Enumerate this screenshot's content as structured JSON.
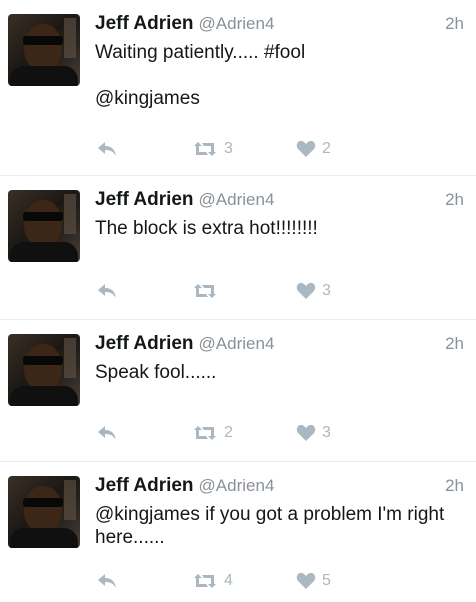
{
  "colors": {
    "icon": "#aab8c2",
    "handle": "#8a9298",
    "divider": "#e6ecf0"
  },
  "tweets": [
    {
      "name": "Jeff Adrien",
      "handle": "@Adrien4",
      "time": "2h",
      "text": "Waiting patiently..... #fool\n\n@kingjames",
      "retweets": "3",
      "likes": "2"
    },
    {
      "name": "Jeff Adrien",
      "handle": "@Adrien4",
      "time": "2h",
      "text": "The block is extra hot!!!!!!!!",
      "retweets": "",
      "likes": "3"
    },
    {
      "name": "Jeff Adrien",
      "handle": "@Adrien4",
      "time": "2h",
      "text": "Speak fool......",
      "retweets": "2",
      "likes": "3"
    },
    {
      "name": "Jeff Adrien",
      "handle": "@Adrien4",
      "time": "2h",
      "text": "@kingjames if you got a problem I'm right here......",
      "retweets": "4",
      "likes": "5"
    }
  ]
}
